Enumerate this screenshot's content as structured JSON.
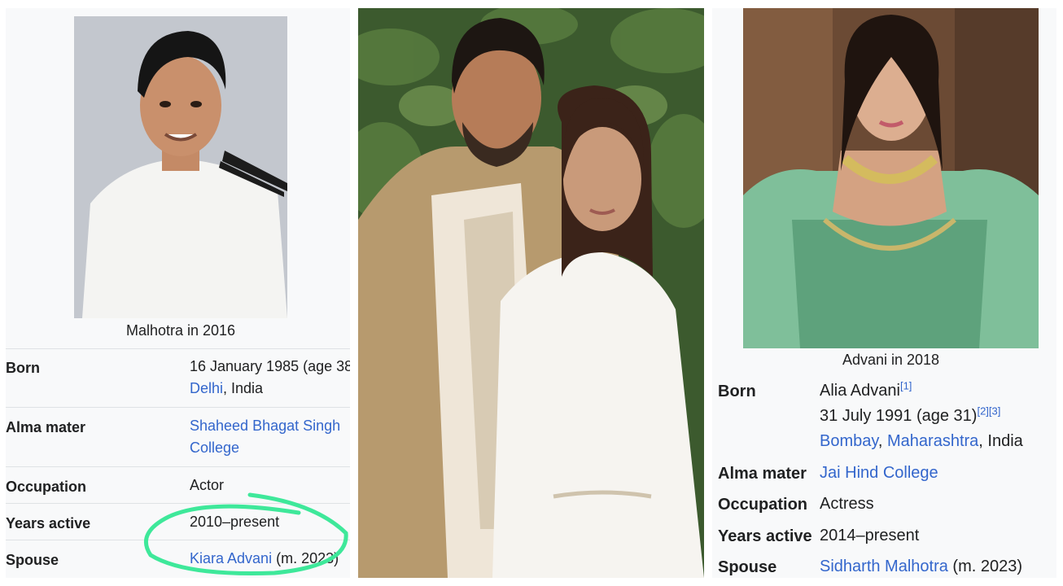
{
  "left": {
    "caption": "Malhotra in 2016",
    "born_label": "Born",
    "born_date": "16 January 1985 (age 38",
    "born_city": "Delhi",
    "born_country": ", India",
    "alma_label": "Alma mater",
    "alma_line1": "Shaheed Bhagat Singh",
    "alma_line2": "College",
    "occupation_label": "Occupation",
    "occupation_value": "Actor",
    "years_label": "Years active",
    "years_value": "2010–present",
    "spouse_label": "Spouse",
    "spouse_name": "Kiara Advani",
    "spouse_year": " (m. 2023)"
  },
  "right": {
    "caption": "Advani in 2018",
    "born_label": "Born",
    "born_name": "Alia Advani",
    "born_name_ref": "[1]",
    "born_date": "31 July 1991 (age 31)",
    "born_date_refs": "[2][3]",
    "born_city": "Bombay",
    "born_sep": ", ",
    "born_state": "Maharashtra",
    "born_country": ", India",
    "alma_label": "Alma mater",
    "alma_value": "Jai Hind College",
    "occupation_label": "Occupation",
    "occupation_value": "Actress",
    "years_label": "Years active",
    "years_value": "2014–present",
    "spouse_label": "Spouse",
    "spouse_name": "Sidharth Malhotra",
    "spouse_year": " (m. 2023)"
  },
  "colors": {
    "link": "#3366cc",
    "highlight": "#3ee89a",
    "infobox_bg": "#f8f9fa"
  }
}
